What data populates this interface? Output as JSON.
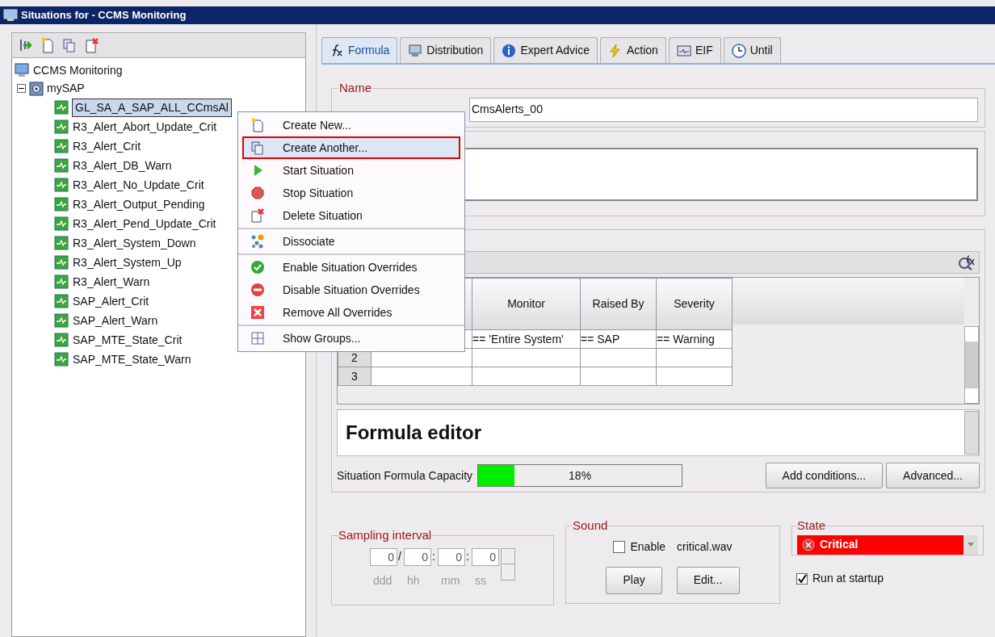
{
  "window": {
    "title": "Situations for - CCMS Monitoring"
  },
  "tree": {
    "root": "CCMS Monitoring",
    "children": [
      {
        "label": "mySAP",
        "expanded": true,
        "children": [
          {
            "label": "GL_SA_A_SAP_ALL_CCmsAl",
            "selected": true
          },
          {
            "label": "R3_Alert_Abort_Update_Crit",
            "selected": false
          },
          {
            "label": "R3_Alert_Crit",
            "selected": false
          },
          {
            "label": "R3_Alert_DB_Warn",
            "selected": false
          },
          {
            "label": "R3_Alert_No_Update_Crit",
            "selected": false
          },
          {
            "label": "R3_Alert_Output_Pending",
            "selected": false
          },
          {
            "label": "R3_Alert_Pend_Update_Crit",
            "selected": false
          },
          {
            "label": "R3_Alert_System_Down",
            "selected": false
          },
          {
            "label": "R3_Alert_System_Up",
            "selected": false
          },
          {
            "label": "R3_Alert_Warn",
            "selected": false
          },
          {
            "label": "SAP_Alert_Crit",
            "selected": false
          },
          {
            "label": "SAP_Alert_Warn",
            "selected": false
          },
          {
            "label": "SAP_MTE_State_Crit",
            "selected": false
          },
          {
            "label": "SAP_MTE_State_Warn",
            "selected": false
          }
        ]
      }
    ]
  },
  "context_menu": [
    {
      "label": "Create New...",
      "selected": false,
      "separator_after": false
    },
    {
      "label": "Create Another...",
      "selected": true,
      "separator_after": false
    },
    {
      "label": "Start Situation",
      "selected": false,
      "separator_after": false
    },
    {
      "label": "Stop Situation",
      "selected": false,
      "separator_after": false
    },
    {
      "label": "Delete Situation",
      "selected": false,
      "separator_after": true
    },
    {
      "label": "Dissociate",
      "selected": false,
      "separator_after": true
    },
    {
      "label": "Enable Situation Overrides",
      "selected": false,
      "separator_after": false
    },
    {
      "label": "Disable Situation Overrides",
      "selected": false,
      "separator_after": false
    },
    {
      "label": "Remove All Overrides",
      "selected": false,
      "separator_after": true
    },
    {
      "label": "Show Groups...",
      "selected": false,
      "separator_after": false
    }
  ],
  "tabs": [
    {
      "label": "Formula",
      "selected": true
    },
    {
      "label": "Distribution",
      "selected": false
    },
    {
      "label": "Expert Advice",
      "selected": false
    },
    {
      "label": "Action",
      "selected": false
    },
    {
      "label": "EIF",
      "selected": false
    },
    {
      "label": "Until",
      "selected": false
    }
  ],
  "name": {
    "label": "Name",
    "value": "CmsAlerts_00"
  },
  "formula_table": {
    "columns": [
      "",
      "",
      "Monitor",
      "Raised By",
      "Severity"
    ],
    "rows": [
      [
        "",
        "",
        "== 'Entire System'",
        "== SAP",
        "== Warning"
      ],
      [
        "2",
        "",
        "",
        "",
        ""
      ],
      [
        "3",
        "",
        "",
        "",
        ""
      ]
    ]
  },
  "formula_editor": {
    "title": "Formula editor"
  },
  "capacity": {
    "label": "Situation Formula Capacity",
    "level": 0.18,
    "reading": "18%"
  },
  "buttons": [
    "Add conditions...",
    "Advanced..."
  ],
  "sampling_interval": {
    "label": "Sampling interval",
    "fields": [
      {
        "value": "0",
        "unit": "ddd",
        "sep": "/"
      },
      {
        "value": "0",
        "unit": "hh",
        "sep": ":"
      },
      {
        "value": "0",
        "unit": "mm",
        "sep": ":"
      },
      {
        "value": "0",
        "unit": "ss"
      }
    ]
  },
  "sound": {
    "label": "Sound",
    "enable_label": "Enable",
    "checked": false,
    "file": "critical.wav",
    "buttons": [
      "Play",
      "Edit..."
    ]
  },
  "state": {
    "label": "State",
    "value": "Critical",
    "color": "#ff0000"
  },
  "run_at_startup": {
    "label": "Run at startup",
    "checked": true
  }
}
